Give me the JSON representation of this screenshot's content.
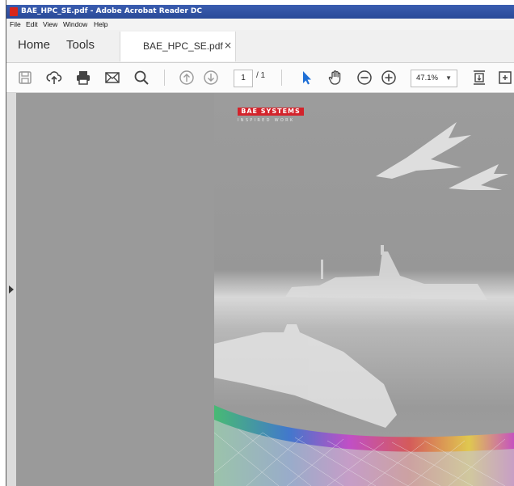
{
  "window": {
    "title": "BAE_HPC_SE.pdf - Adobe Acrobat Reader DC"
  },
  "menu": {
    "items": [
      {
        "label": "File"
      },
      {
        "label": "Edit"
      },
      {
        "label": "View"
      },
      {
        "label": "Window"
      },
      {
        "label": "Help"
      }
    ]
  },
  "tabs": {
    "home": "Home",
    "tools": "Tools",
    "document": "BAE_HPC_SE.pdf",
    "close": "×"
  },
  "toolbar": {
    "icons": [
      "save-icon",
      "upload-icon",
      "print-icon",
      "email-icon",
      "search-icon",
      "prev-page-icon",
      "next-page-icon",
      "select-pointer-icon",
      "hand-pan-icon",
      "zoom-out-icon",
      "zoom-in-icon",
      "fit-page-icon",
      "more-tools-icon"
    ],
    "current_page": "1",
    "page_total": "/ 1",
    "zoom": "47.1%",
    "zoom_caret": "▼"
  },
  "document": {
    "logo_text": "BAE SYSTEMS",
    "tagline": "INSPIRED WORK"
  },
  "colors": {
    "titlebar": "#2a4a98",
    "logo_red": "#d3232b",
    "pointer_blue": "#1f6fd6"
  }
}
